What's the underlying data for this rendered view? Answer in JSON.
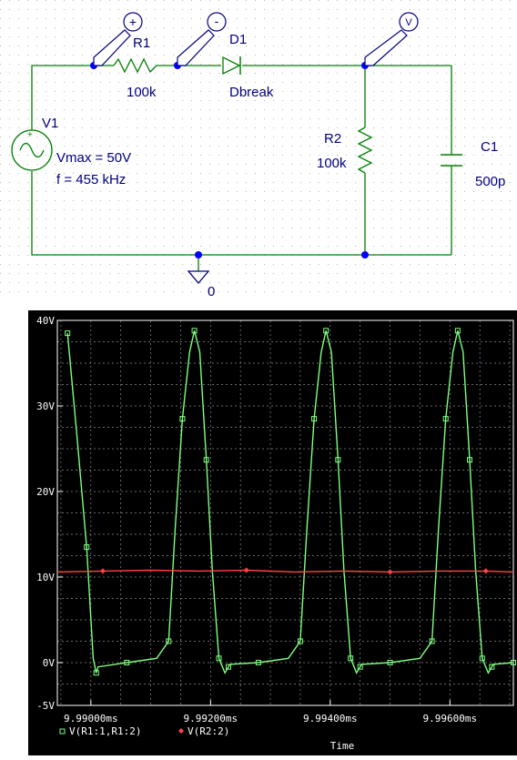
{
  "schematic": {
    "colors": {
      "wire": "#008000",
      "label": "#000080",
      "dot": "#0000ff",
      "probe": "#000080"
    },
    "components": {
      "r1": {
        "ref": "R1",
        "value": "100k"
      },
      "d1": {
        "ref": "D1",
        "value": "Dbreak"
      },
      "v1": {
        "ref": "V1",
        "params": [
          "Vmax = 50V",
          "f = 455 kHz"
        ]
      },
      "r2": {
        "ref": "R2",
        "value": "100k"
      },
      "c1": {
        "ref": "C1",
        "value": "500p"
      }
    },
    "probes": {
      "plus": "+",
      "minus": "-",
      "volt": "V"
    },
    "ground": {
      "label": "0"
    }
  },
  "chart_data": {
    "type": "line",
    "title": "",
    "xlabel": "Time",
    "ylabel": "",
    "x_unit": "ms",
    "xlim": [
      9.98944,
      9.99706
    ],
    "ylim": [
      -5,
      40
    ],
    "yticks": [
      -5,
      0,
      10,
      20,
      30,
      40
    ],
    "yticklabels": [
      "-5V",
      "0V",
      "10V",
      "20V",
      "30V",
      "40V"
    ],
    "xticks": [
      9.99,
      9.992,
      9.994,
      9.996
    ],
    "xticklabels": [
      "9.99000ms",
      "9.99200ms",
      "9.99400ms",
      "9.99600ms"
    ],
    "grid": true,
    "background": "#000000",
    "legend": "bottom-left",
    "period_ms": 0.0021978,
    "series": [
      {
        "name": "V(R1:1,R1:2)",
        "color": "#7fff7f",
        "marker": "square",
        "x": [
          9.98961,
          9.98977,
          9.98993,
          9.99004,
          9.99009,
          9.99012,
          9.9906,
          9.9911,
          9.9913,
          9.99141,
          9.99153,
          9.99165,
          9.99173,
          9.99182,
          9.99193,
          9.99203,
          9.99214,
          9.99224,
          9.9923,
          9.99232,
          9.9928,
          9.9933,
          9.9935,
          9.99361,
          9.99373,
          9.99385,
          9.99393,
          9.99402,
          9.99413,
          9.99423,
          9.99434,
          9.99444,
          9.9945,
          9.99452,
          9.995,
          9.9955,
          9.9957,
          9.99581,
          9.99593,
          9.99605,
          9.99613,
          9.99622,
          9.99633,
          9.99643,
          9.99654,
          9.99664,
          9.9967,
          9.99672,
          9.99706
        ],
        "y": [
          38.5,
          26.3,
          13.5,
          0.5,
          -1.2,
          -0.5,
          0,
          0.5,
          2.5,
          15.7,
          28.5,
          36.3,
          38.8,
          36.3,
          23.7,
          10.7,
          0.5,
          -1.2,
          -0.5,
          -0.2,
          0,
          0.5,
          2.5,
          15.7,
          28.5,
          36.3,
          38.8,
          36.3,
          23.7,
          10.7,
          0.5,
          -1.2,
          -0.5,
          -0.2,
          0,
          0.5,
          2.5,
          15.7,
          28.5,
          36.3,
          38.8,
          36.3,
          23.7,
          10.7,
          0.5,
          -1.2,
          -0.5,
          -0.2,
          0
        ]
      },
      {
        "name": "V(R2:2)",
        "color": "#ff4444",
        "marker": "diamond",
        "x": [
          9.98944,
          9.9902,
          9.991,
          9.9918,
          9.9926,
          9.9934,
          9.9942,
          9.995,
          9.9958,
          9.9966,
          9.99706
        ],
        "y": [
          10.6,
          10.7,
          10.8,
          10.7,
          10.8,
          10.6,
          10.7,
          10.6,
          10.7,
          10.7,
          10.6
        ]
      }
    ]
  }
}
